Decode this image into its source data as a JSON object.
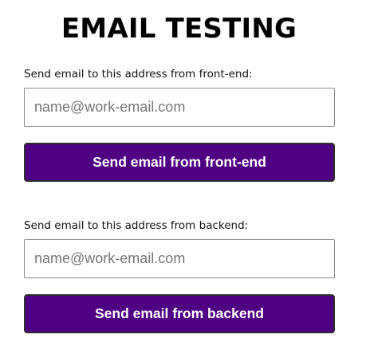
{
  "page": {
    "title": "EMAIL TESTING"
  },
  "frontend": {
    "label": "Send email to this address from front-end:",
    "input_value": "",
    "input_placeholder": "name@work-email.com",
    "button_label": "Send email from front-end"
  },
  "backend": {
    "label": "Send email to this address from backend:",
    "input_value": "",
    "input_placeholder": "name@work-email.com",
    "button_label": "Send email from backend"
  },
  "colors": {
    "button_background": "#4f0082",
    "button_text": "#ffffff",
    "input_border": "#8a8a8a",
    "placeholder": "#767676"
  }
}
